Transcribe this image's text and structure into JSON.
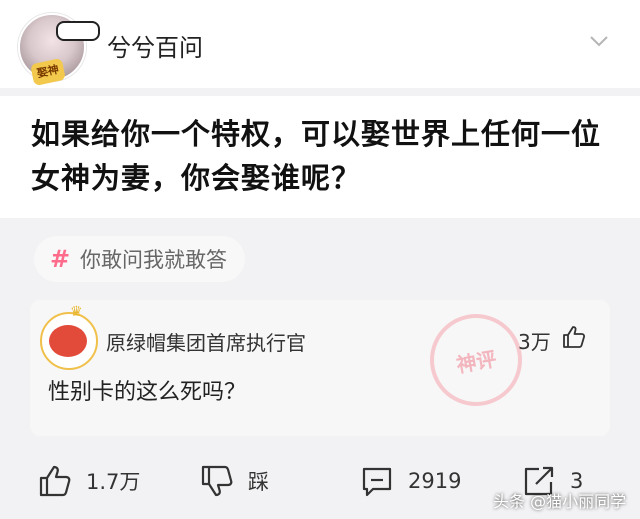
{
  "header": {
    "author_name": "兮兮百问",
    "avatar_badge": "娶神",
    "avatar_icon": "user-avatar",
    "menu_icon": "chevron-down-icon"
  },
  "question": {
    "text": "如果给你一个特权，可以娶世界上任何一位女神为妻，你会娶谁呢？"
  },
  "tag": {
    "icon": "hash-icon",
    "symbol": "#",
    "label": "你敢问我就敢答",
    "color": "#ff6b8b"
  },
  "top_comment": {
    "author": "原绿帽集团首席执行官",
    "likes": "3万",
    "text": "性别卡的这么死吗？",
    "stamp": "神评"
  },
  "actions": {
    "like_count": "1.7万",
    "dislike_label": "踩",
    "comment_count": "2919",
    "share_count": "3"
  },
  "watermark": "头条 @猫小丽同学"
}
